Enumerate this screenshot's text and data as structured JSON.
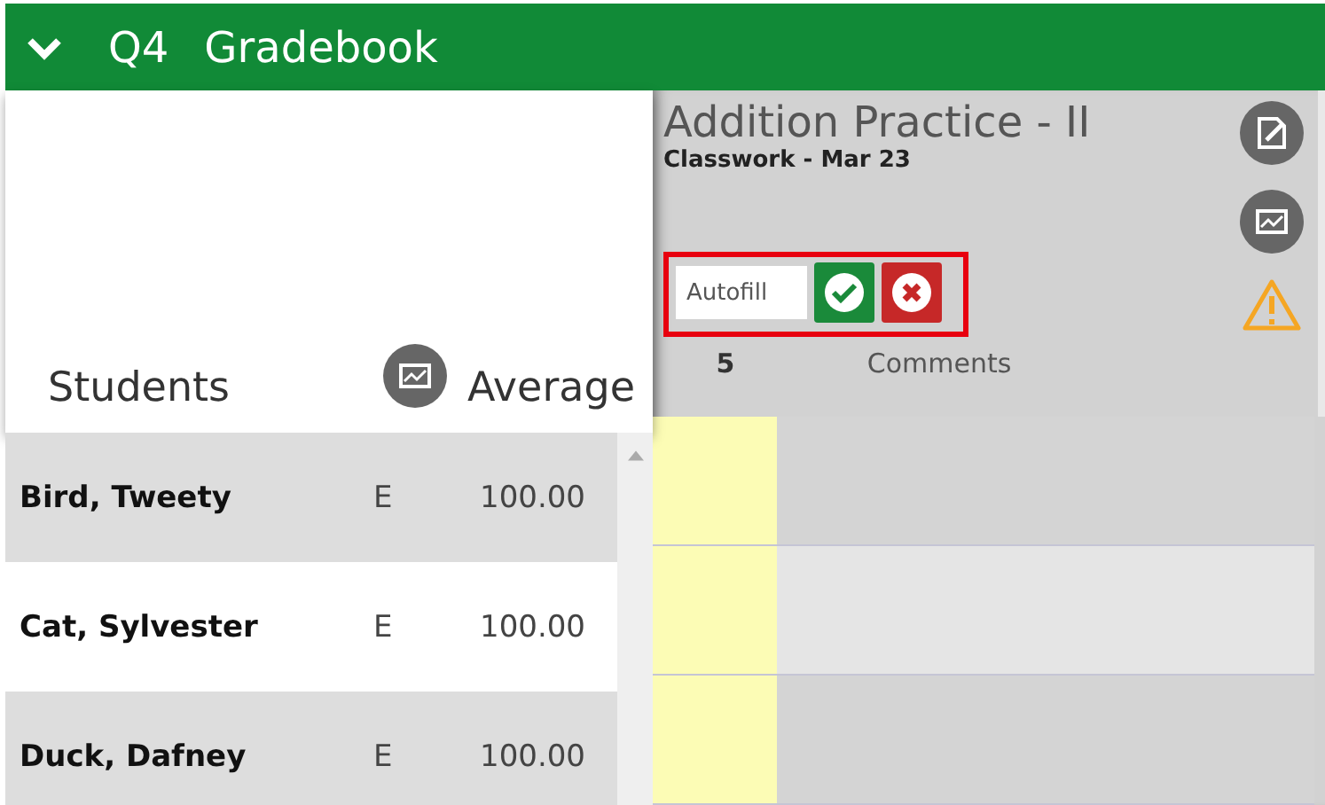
{
  "header": {
    "expanded": true,
    "term": "Q4",
    "title": "Gradebook"
  },
  "students_panel": {
    "students_label": "Students",
    "average_label": "Average"
  },
  "assignment": {
    "title": "Addition Practice - II",
    "subtitle": "Classwork - Mar 23",
    "autofill_placeholder": "Autofill",
    "warning": true
  },
  "grid_columns": [
    "5",
    "Comments"
  ],
  "rows": [
    {
      "name": "Bird, Tweety",
      "grade": "E",
      "average": "100.00"
    },
    {
      "name": "Cat, Sylvester",
      "grade": "E",
      "average": "100.00"
    },
    {
      "name": "Duck, Dafney",
      "grade": "E",
      "average": "100.00"
    }
  ]
}
